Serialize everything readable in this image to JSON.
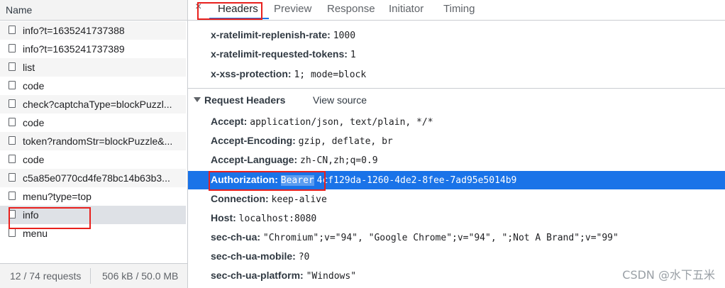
{
  "list": {
    "header": "Name",
    "items": [
      "info?t=1635241737388",
      "info?t=1635241737389",
      "list",
      "code",
      "check?captchaType=blockPuzzl...",
      "code",
      "token?randomStr=blockPuzzle&...",
      "code",
      "c5a85e0770cd4fe78bc14b63b3...",
      "menu?type=top",
      "info",
      "menu"
    ],
    "footer_requests": "12 / 74 requests",
    "footer_size": "506 kB / 50.0 MB"
  },
  "tabs": {
    "close": "×",
    "headers": "Headers",
    "preview": "Preview",
    "response": "Response",
    "initiator": "Initiator",
    "timing": "Timing"
  },
  "response_headers": [
    {
      "name": "x-ratelimit-replenish-rate:",
      "value": "1000"
    },
    {
      "name": "x-ratelimit-requested-tokens:",
      "value": "1"
    },
    {
      "name": "x-xss-protection:",
      "value": "1; mode=block"
    }
  ],
  "request_section": {
    "title": "Request Headers",
    "view_source": "View source"
  },
  "request_headers": [
    {
      "name": "Accept:",
      "value": "application/json, text/plain, */*"
    },
    {
      "name": "Accept-Encoding:",
      "value": "gzip, deflate, br"
    },
    {
      "name": "Accept-Language:",
      "value": "zh-CN,zh;q=0.9"
    },
    {
      "name": "Authorization:",
      "value_a": "Bearer",
      "value_b": "4cf129da-1260-4de2-8fee-7ad95e5014b9"
    },
    {
      "name": "Connection:",
      "value": "keep-alive"
    },
    {
      "name": "Host:",
      "value": "localhost:8080"
    },
    {
      "name": "sec-ch-ua:",
      "value": "\"Chromium\";v=\"94\", \"Google Chrome\";v=\"94\", \";Not A Brand\";v=\"99\""
    },
    {
      "name": "sec-ch-ua-mobile:",
      "value": "?0"
    },
    {
      "name": "sec-ch-ua-platform:",
      "value": "\"Windows\""
    }
  ],
  "watermark": "CSDN @水下五米",
  "colors": {
    "selection": "#1a73e8",
    "highlight_box": "#e8201d"
  }
}
